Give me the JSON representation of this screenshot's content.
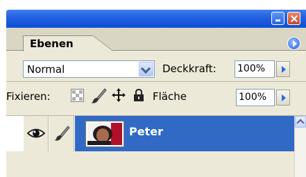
{
  "window": {
    "minimize_icon": "minimize-icon",
    "close_icon": "close-icon",
    "accent": "#0a4fd6",
    "close_color": "#c8452a"
  },
  "tabs": {
    "active_label": "Ebenen",
    "menu_icon": "palette-menu-icon"
  },
  "blend": {
    "mode": "Normal",
    "opacity_label": "Deckkraft:",
    "opacity_value": "100%"
  },
  "lock": {
    "label": "Fixieren:",
    "icons": [
      "lock-transparency-icon",
      "lock-image-icon",
      "lock-position-icon",
      "lock-all-icon"
    ],
    "fill_label": "Fläche",
    "fill_value": "100%"
  },
  "layers": [
    {
      "name": "Peter",
      "visible_icon": "eye-icon",
      "edit_icon": "brush-icon",
      "selected": true,
      "selection_color": "#316ac5"
    }
  ]
}
